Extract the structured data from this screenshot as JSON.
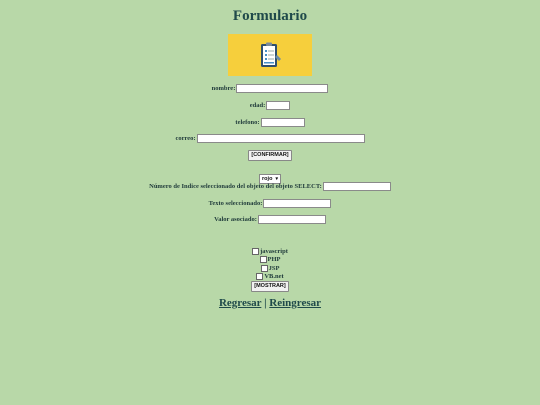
{
  "page": {
    "title": "Formulario"
  },
  "banner": {
    "icon": "clipboard-checklist-icon",
    "bg_color": "#f6cf3c"
  },
  "form1": {
    "nombre_label": "nombre:",
    "edad_label": "edad:",
    "telefono_label": "telefono:",
    "correo_label": "correo:",
    "confirm_label": "[CONFIRMAR]"
  },
  "form2": {
    "select_value": "rojo",
    "indice_label": "Número de Indice seleccionado del objeto del objeto SELECT:",
    "texto_label": "Texto seleccionado:",
    "valor_label": "Valor asociado:"
  },
  "form3": {
    "options": [
      "javascript",
      "PHP",
      "JSP",
      "VB.net"
    ],
    "show_label": "[MOSTRAR]"
  },
  "footer": {
    "regresar": "Regresar",
    "separator": "|",
    "reingresar": "Reingresar"
  }
}
